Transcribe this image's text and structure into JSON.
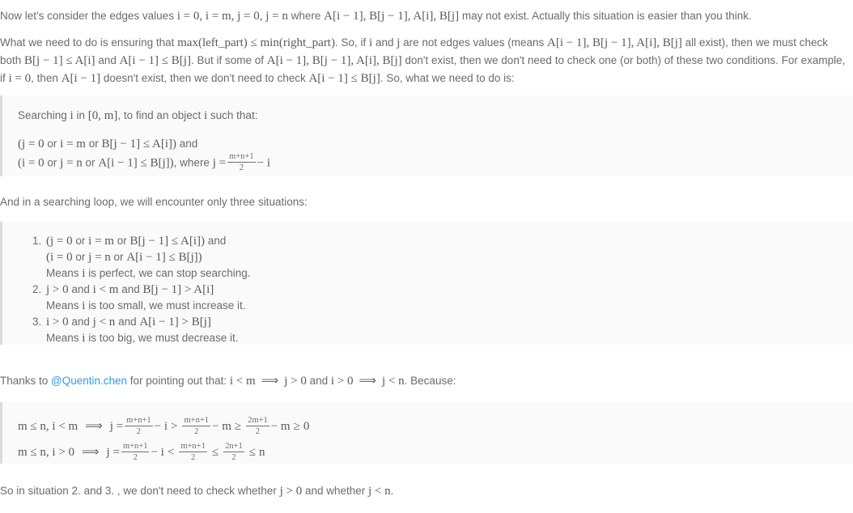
{
  "document": {
    "type": "markdown-article-rendered-with-latex",
    "background_color": "#ffffff",
    "text_color": "#6b6b6b",
    "link_color": "#2e9bf0",
    "blockquote_background": "#fafafa",
    "blockquote_border": "#dcdcdc"
  },
  "paragraph1": {
    "seg1": "Now let's consider the edges values ",
    "math1": "i = 0, i = m, j = 0, j = n",
    "seg2": " where ",
    "math2": "A[i − 1], B[j − 1], A[i], B[j]",
    "seg3": " may not exist. Actually this situation is easier than you think."
  },
  "paragraph2": {
    "seg1": "What we need to do is ensuring that ",
    "math1": "max(left_part) ≤ min(right_part)",
    "seg2": ". So, if ",
    "math2": "i",
    "seg3": " and ",
    "math3": "j",
    "seg4": " are not edges values (means ",
    "math4": "A[i − 1], B[j − 1], A[i], B[j]",
    "seg5": " all exist), then we must check both ",
    "math5": "B[j − 1] ≤ A[i]",
    "seg6": " and ",
    "math6": "A[i − 1] ≤ B[j]",
    "seg7": ". But if some of ",
    "math7": "A[i − 1], B[j − 1], A[i], B[j]",
    "seg8": " don't exist, then we don't need to check one (or both) of these two conditions. For example, if ",
    "math8": "i = 0",
    "seg9": ", then ",
    "math9": "A[i − 1]",
    "seg10": " doesn't exist, then we don't need to check ",
    "math10": "A[i − 1] ≤ B[j]",
    "seg11": ". So, what we need to do is:"
  },
  "blockquote1": {
    "line1": {
      "seg1": "Searching ",
      "math1": "i",
      "seg2": " in ",
      "math2": "[0, m]",
      "seg3": ", to find an object ",
      "math3": "i",
      "seg4": " such that:"
    },
    "line2": {
      "math_open": "(",
      "math1": "j = 0",
      "or1": " or ",
      "math2": "i = m",
      "or2": " or ",
      "math3": "B[j − 1] ≤ A[i]",
      "math_close": ")",
      "tail": " and"
    },
    "line3": {
      "math_open": "(",
      "math1": "i = 0",
      "or1": " or ",
      "math2": "j = n",
      "or2": " or ",
      "math3": "A[i − 1] ≤ B[j]",
      "math_close": ")",
      "tail": ", where ",
      "math4_lead": "j =",
      "frac_num": "m+n+1",
      "frac_den": "2",
      "math4_tail": "− i"
    }
  },
  "paragraph3": {
    "text": "And in a searching loop, we will encounter only three situations:"
  },
  "blockquote2": {
    "items": [
      {
        "number": "1.",
        "line_a_open": "(",
        "line_a_m1": "j = 0",
        "line_a_or1": " or ",
        "line_a_m2": "i = m",
        "line_a_or2": " or ",
        "line_a_m3": "B[j − 1] ≤ A[i]",
        "line_a_close": ")",
        "line_a_tail": " and",
        "line_b_open": "(",
        "line_b_m1": "i = 0",
        "line_b_or1": " or ",
        "line_b_m2": "j = n",
        "line_b_or2": " or ",
        "line_b_m3": "A[i − 1] ≤ B[j]",
        "line_b_close": ")",
        "means_pre": "Means ",
        "means_math": "i",
        "means_post": " is perfect, we can stop searching."
      },
      {
        "number": "2.",
        "cond_m1": "j > 0",
        "cond_and1": " and ",
        "cond_m2": "i < m",
        "cond_and2": " and ",
        "cond_m3": "B[j − 1] > A[i]",
        "means_pre": "Means ",
        "means_math": "i",
        "means_post": " is too small, we must increase it."
      },
      {
        "number": "3.",
        "cond_m1": "i > 0",
        "cond_and1": " and ",
        "cond_m2": "j < n",
        "cond_and2": " and ",
        "cond_m3": "A[i − 1] > B[j]",
        "means_pre": "Means ",
        "means_math": "i",
        "means_post": " is too big, we must decrease it."
      }
    ]
  },
  "paragraph4": {
    "seg1": "Thanks to ",
    "link_text": "@Quentin.chen",
    "seg2": " for pointing out that: ",
    "math1": "i < m",
    "implies1": "⟹",
    "math2": "j > 0",
    "seg3": " and ",
    "math3": "i > 0",
    "implies2": "⟹",
    "math4": "j < n",
    "seg4": ". Because:"
  },
  "blockquote3": {
    "line1": {
      "lead": "m ≤ n, i < m",
      "implies": "⟹",
      "j_eq": "j =",
      "f1_num": "m+n+1",
      "f1_den": "2",
      "minus_i": "− i",
      "gt": ">",
      "f2_num": "m+n+1",
      "f2_den": "2",
      "minus_m1": "− m",
      "ge1": "≥",
      "f3_num": "2m+1",
      "f3_den": "2",
      "minus_m2": "− m",
      "ge2": "≥",
      "zero": "0"
    },
    "line2": {
      "lead": "m ≤ n, i > 0",
      "implies": "⟹",
      "j_eq": "j =",
      "f1_num": "m+n+1",
      "f1_den": "2",
      "minus_i": "− i",
      "lt": "<",
      "f2_num": "m+n+1",
      "f2_den": "2",
      "le1": "≤",
      "f3_num": "2n+1",
      "f3_den": "2",
      "le2": "≤",
      "n": "n"
    }
  },
  "paragraph5": {
    "seg1": "So in situation 2. and 3. , we don't need to check whether ",
    "math1": "j > 0",
    "seg2": " and whether ",
    "math2": "j < n",
    "seg3": "."
  }
}
